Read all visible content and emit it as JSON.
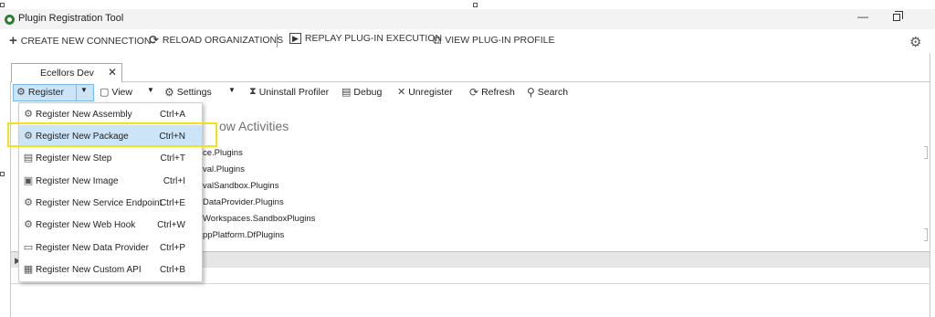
{
  "window": {
    "title": "Plugin Registration Tool",
    "minimize_glyph": "—"
  },
  "commands": [
    {
      "icon": "plus-icon",
      "glyph": "+",
      "label": "CREATE NEW CONNECTION"
    },
    {
      "icon": "reload-icon",
      "glyph": "⟳",
      "label": "RELOAD ORGANIZATIONS"
    },
    {
      "icon": "replay-icon",
      "glyph": "▶",
      "label": "REPLAY PLUG-IN EXECUTION"
    },
    {
      "icon": "profile-icon",
      "glyph": "⧉",
      "label": "VIEW PLUG-IN PROFILE"
    }
  ],
  "tab": {
    "label": "Ecellors Dev",
    "close_glyph": "✕"
  },
  "toolbar": {
    "register": "Register",
    "view": "View",
    "settings": "Settings",
    "uninstall_profiler": "Uninstall Profiler",
    "debug": "Debug",
    "unregister": "Unregister",
    "refresh": "Refresh",
    "search": "Search",
    "dropdown_glyph": "▼"
  },
  "background": {
    "heading_partial": "ow Activities",
    "items": [
      "ce.Plugins",
      "val.Plugins",
      "valSandbox.Plugins",
      "DataProvider.Plugins",
      "Workspaces.SandboxPlugins",
      "ppPlatform.DfPlugins"
    ],
    "band_arrow": "▶"
  },
  "register_menu": [
    {
      "icon": "assembly-icon",
      "glyph": "⚙",
      "label": "Register New Assembly",
      "shortcut": "Ctrl+A",
      "highlighted": false
    },
    {
      "icon": "package-icon",
      "glyph": "⚙",
      "label": "Register New Package",
      "shortcut": "Ctrl+N",
      "highlighted": true
    },
    {
      "icon": "step-icon",
      "glyph": "▤",
      "label": "Register New Step",
      "shortcut": "Ctrl+T",
      "highlighted": false
    },
    {
      "icon": "image-icon",
      "glyph": "▣",
      "label": "Register New Image",
      "shortcut": "Ctrl+I",
      "highlighted": false
    },
    {
      "icon": "service-endpoint-icon",
      "glyph": "⚙",
      "label": "Register New Service Endpoint",
      "shortcut": "Ctrl+E",
      "highlighted": false
    },
    {
      "icon": "web-hook-icon",
      "glyph": "⚙",
      "label": "Register New Web Hook",
      "shortcut": "Ctrl+W",
      "highlighted": false
    },
    {
      "icon": "data-provider-icon",
      "glyph": "▭",
      "label": "Register New Data Provider",
      "shortcut": "Ctrl+P",
      "highlighted": false
    },
    {
      "icon": "custom-api-icon",
      "glyph": "▦",
      "label": "Register New Custom API",
      "shortcut": "Ctrl+B",
      "highlighted": false
    }
  ],
  "colors": {
    "menu_highlight": "#cce4f7",
    "callout": "#f2e21b",
    "app_icon": "#2e7d32"
  }
}
